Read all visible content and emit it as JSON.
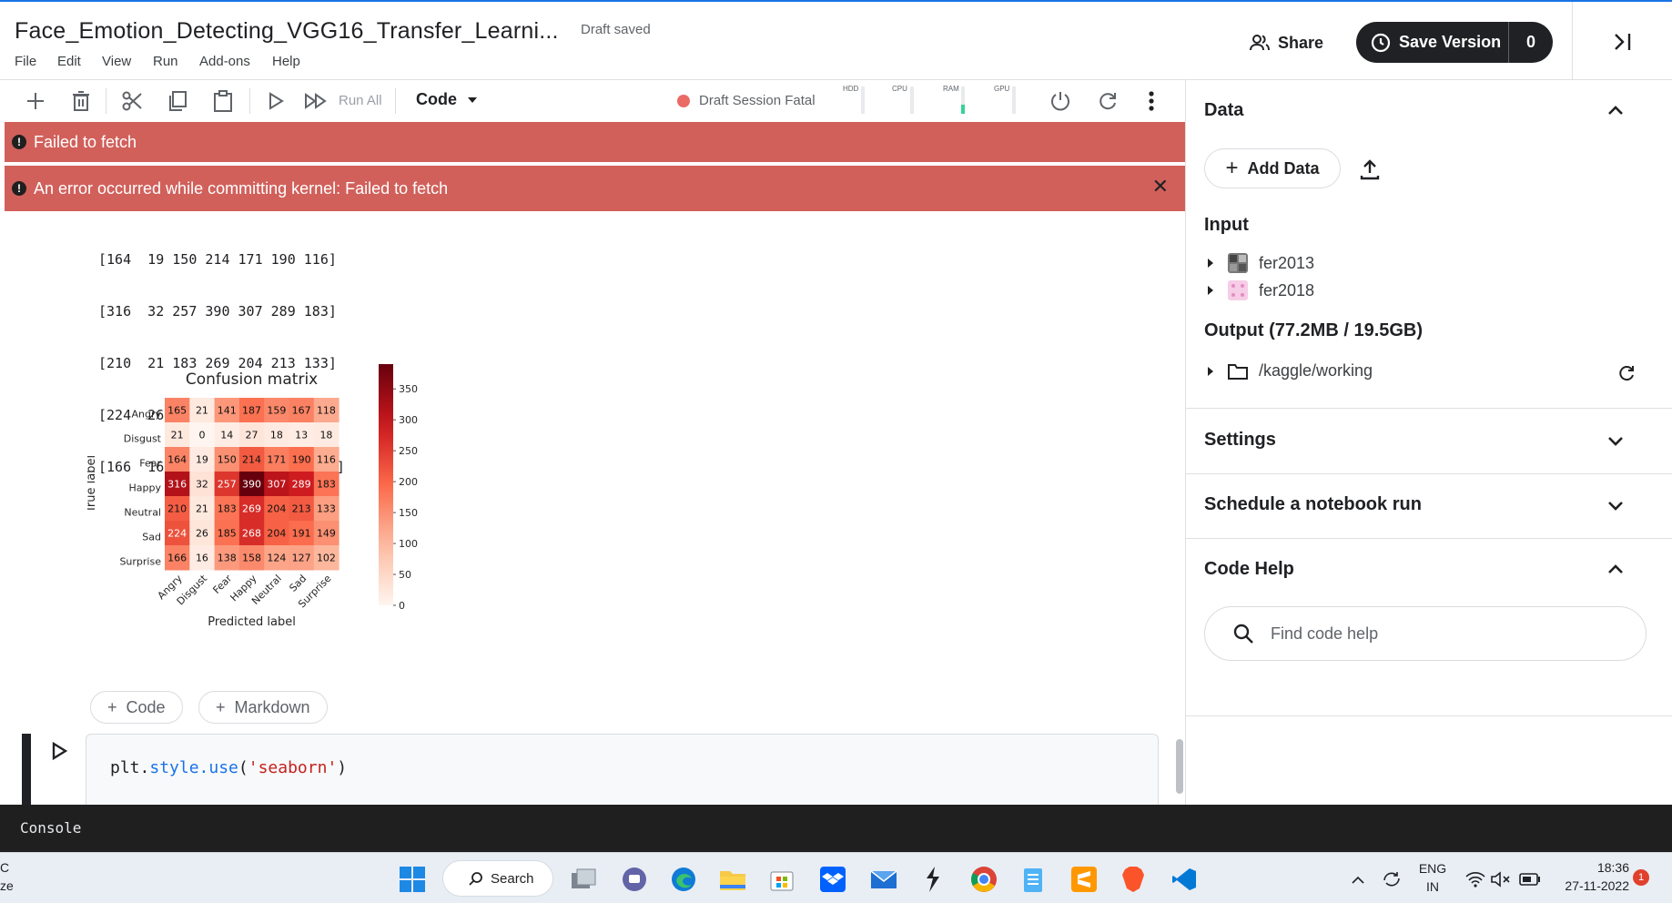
{
  "header": {
    "title": "Face_Emotion_Detecting_VGG16_Transfer_Learni...",
    "draft_status": "Draft saved",
    "menu": [
      "File",
      "Edit",
      "View",
      "Run",
      "Add-ons",
      "Help"
    ],
    "share_label": "Share",
    "save_version_label": "Save Version",
    "save_version_count": "0"
  },
  "toolbar": {
    "run_all_label": "Run All",
    "cell_type": "Code",
    "session_status": "Draft Session Fatal",
    "meters": [
      {
        "label": "HDD",
        "level": 0.0
      },
      {
        "label": "CPU",
        "level": 0.0
      },
      {
        "label": "RAM",
        "level": 0.35
      },
      {
        "label": "GPU",
        "level": 0.0
      }
    ]
  },
  "banners": {
    "fetch_error": "Failed to fetch",
    "kernel_error": "An error occurred while committing kernel: Failed to fetch"
  },
  "output": {
    "matrix_lines": [
      "[164  19 150 214 171 190 116]",
      "[316  32 257 390 307 289 183]",
      "[210  21 183 269 204 213 133]",
      "[224  26 185 268 204 191 149]",
      "[166  16 138 158 124 127 102]]"
    ]
  },
  "chart_data": {
    "type": "heatmap",
    "title": "Confusion matrix",
    "xlabel": "Predicted label",
    "ylabel": "True label",
    "x_categories": [
      "Angry",
      "Disgust",
      "Fear",
      "Happy",
      "Neutral",
      "Sad",
      "Surprise"
    ],
    "y_categories": [
      "Angry",
      "Disgust",
      "Fear",
      "Happy",
      "Neutral",
      "Sad",
      "Surprise"
    ],
    "values": [
      [
        165,
        21,
        141,
        187,
        159,
        167,
        118
      ],
      [
        21,
        0,
        14,
        27,
        18,
        13,
        18
      ],
      [
        164,
        19,
        150,
        214,
        171,
        190,
        116
      ],
      [
        316,
        32,
        257,
        390,
        307,
        289,
        183
      ],
      [
        210,
        21,
        183,
        269,
        204,
        213,
        133
      ],
      [
        224,
        26,
        185,
        268,
        204,
        191,
        149
      ],
      [
        166,
        16,
        138,
        158,
        124,
        127,
        102
      ]
    ],
    "colorbar_ticks": [
      0,
      50,
      100,
      150,
      200,
      250,
      300,
      350
    ],
    "vmin": 0,
    "vmax": 390,
    "colormap": "Reds"
  },
  "cell_actions": {
    "add_code": "Code",
    "add_markdown": "Markdown"
  },
  "code_cell": {
    "code_prefix": "plt.",
    "code_fn": "style.use",
    "code_open": "(",
    "code_string": "'seaborn'",
    "code_close": ")"
  },
  "sidebar": {
    "data_heading": "Data",
    "add_data_label": "Add Data",
    "input_heading": "Input",
    "inputs": [
      "fer2013",
      "fer2018"
    ],
    "output_heading": "Output (77.2MB / 19.5GB)",
    "output_path": "/kaggle/working",
    "settings_heading": "Settings",
    "schedule_heading": "Schedule a notebook run",
    "code_help_heading": "Code Help",
    "code_help_placeholder": "Find code help"
  },
  "console_label": "Console",
  "taskbar": {
    "search_label": "Search",
    "lang_top": "ENG",
    "lang_bottom": "IN",
    "time": "18:36",
    "date": "27-11-2022",
    "notification_count": "1",
    "edge_text_top": "C",
    "edge_text_bottom": "ze"
  },
  "colors": {
    "accent_dark": "#202124",
    "error_banner": "#d1605b",
    "session_dot": "#ea6b66"
  }
}
